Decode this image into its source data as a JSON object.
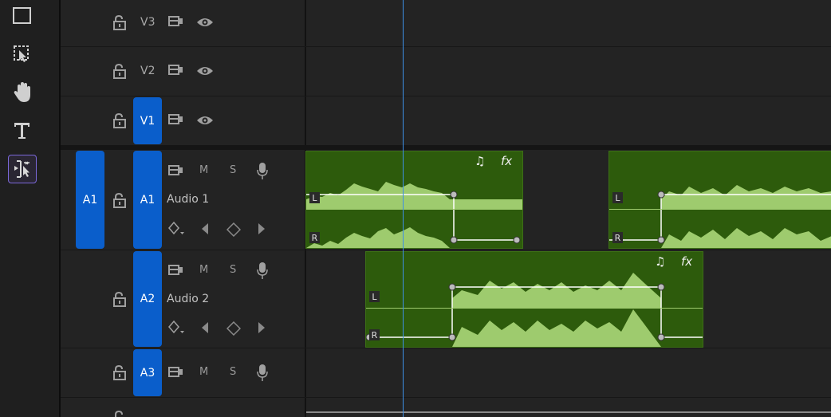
{
  "tools": [
    "rectangle-tool",
    "track-select-tool",
    "hand-tool",
    "type-tool",
    "ripple-edit-tool"
  ],
  "video_tracks": [
    {
      "id": "V3",
      "targeted": false
    },
    {
      "id": "V2",
      "targeted": false
    },
    {
      "id": "V1",
      "targeted": true
    }
  ],
  "audio_tracks": [
    {
      "id": "A1",
      "source": "A1",
      "name": "Audio 1",
      "targeted": true
    },
    {
      "id": "A2",
      "name": "Audio 2",
      "targeted": true
    },
    {
      "id": "A3",
      "targeted": true
    }
  ],
  "mute_label": "M",
  "solo_label": "S",
  "channel_left": "L",
  "channel_right": "R",
  "clip_icons": {
    "music": "♫",
    "fx": "fx"
  },
  "colors": {
    "target": "#0a5ecb",
    "clip": "#2d5b0c",
    "wave": "#9ecb6e",
    "playhead": "#3d8fe6",
    "tool_active": "#7b68d9"
  }
}
